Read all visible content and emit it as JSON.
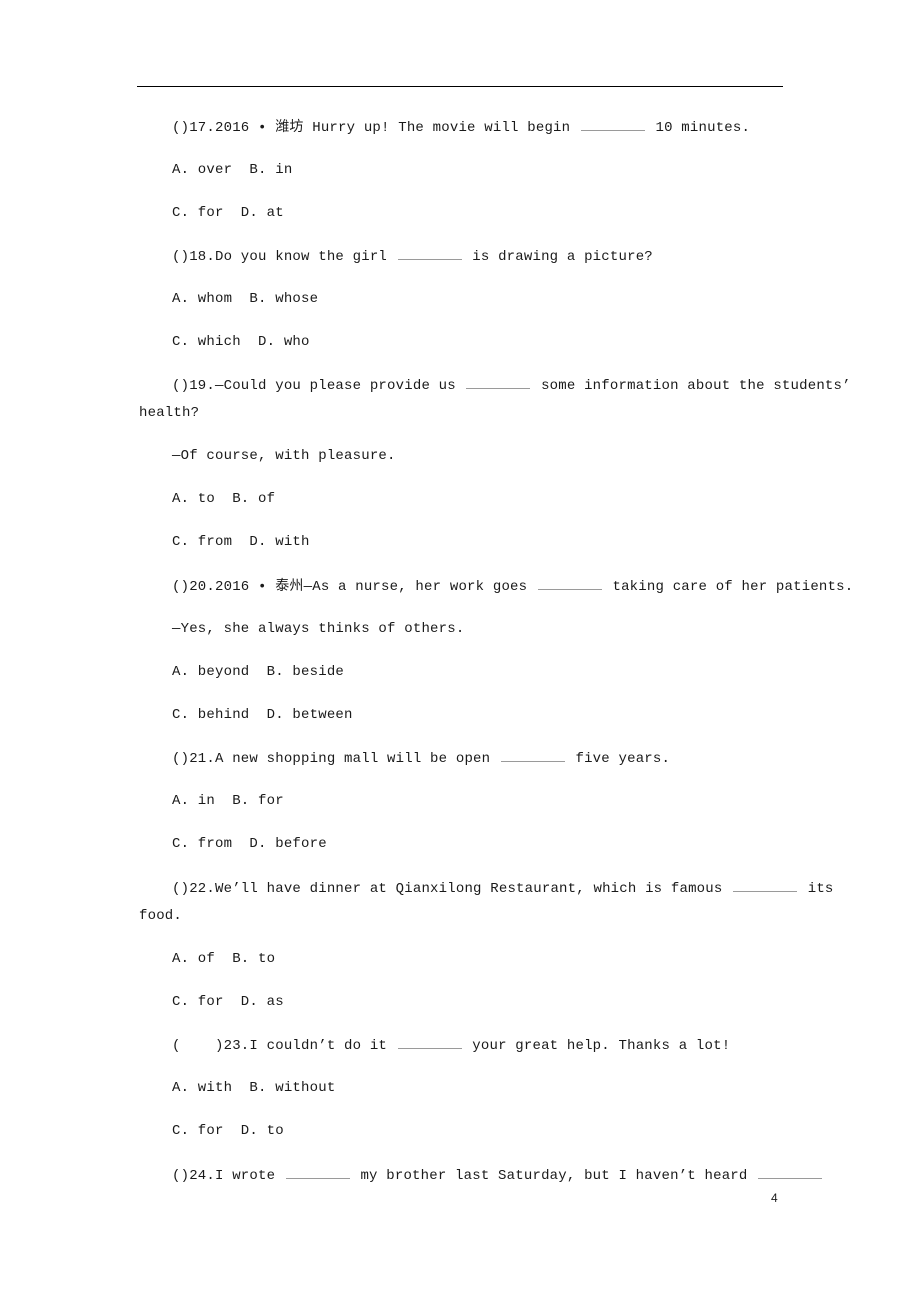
{
  "page_number": "4",
  "questions": [
    {
      "prefix": "()17.2016 • 潍坊 Hurry up! The movie will begin",
      "suffix": "10 minutes.",
      "opt1": "A. over  B. in",
      "opt2": "C. for  D. at"
    },
    {
      "prefix": "()18.Do you know the girl",
      "suffix": "is drawing a picture?",
      "opt1": "A. whom  B. whose",
      "opt2": "C. which  D. who"
    },
    {
      "prefix": "()19.—Could you please provide us",
      "suffix": "some information about the students’",
      "cont": "health?",
      "reply": "—Of course, with pleasure.",
      "opt1": "A. to  B. of",
      "opt2": "C. from  D. with"
    },
    {
      "prefix": "()20.2016 • 泰州—As a nurse, her work goes",
      "suffix": "taking care of her patients.",
      "reply": "—Yes, she always thinks of others.",
      "opt1": "A. beyond  B. beside",
      "opt2": "C. behind  D. between"
    },
    {
      "prefix": "()21.A new shopping mall will be open",
      "suffix": "five years.",
      "opt1": "A. in  B. for",
      "opt2": "C. from  D. before"
    },
    {
      "prefix": "()22.We’ll have dinner at Qianxilong Restaurant, which is famous",
      "suffix": "its",
      "cont": "food.",
      "opt1": "A. of  B. to",
      "opt2": "C. for  D. as"
    },
    {
      "prefix": "(    )23.I couldn’t do it",
      "suffix": "your great help. Thanks a lot!",
      "opt1": "A. with  B. without",
      "opt2": "C. for  D. to"
    },
    {
      "prefix": "()24.I wrote",
      "middle": "my brother last Saturday, but I haven’t heard",
      "suffix": ""
    }
  ]
}
